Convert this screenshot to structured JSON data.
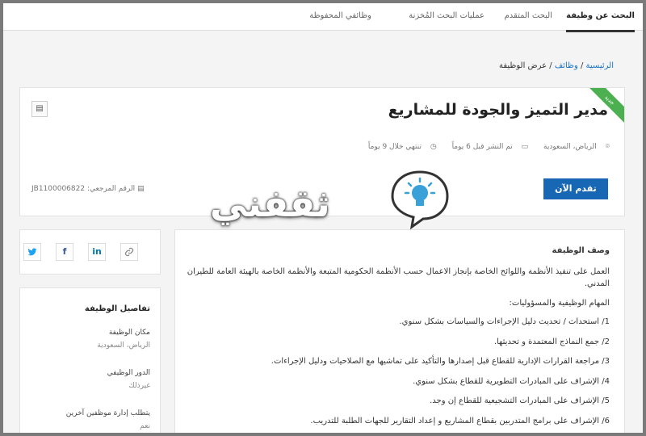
{
  "tabs": [
    "البحث عن وظيفة",
    "البحث المتقدم",
    "عمليات البحث المُخزنة",
    "وظائفي المحفوظة"
  ],
  "breadcrumb": {
    "home": "الرئيسية",
    "sep": " / ",
    "jobs": "وظائف",
    "current": "عرض الوظيفة"
  },
  "job": {
    "title": "مدير التميز والجودة للمشاريع",
    "badge": "جديد",
    "location": "الرياض، السعودية",
    "posted": "تم النشر قبل 6 يوماً",
    "ends": "تنتهي خلال 9 يوماً",
    "apply_label": "تقدم الآن",
    "ref_label": "الرقم المرجعي:",
    "ref_value": "JB1100006822"
  },
  "watermark": {
    "text": "ثقفني"
  },
  "description": {
    "heading": "وصف الوظيفة",
    "intro": "العمل على تنفيذ الأنظمة واللوائح الخاصة بإنجاز الاعمال حسب الأنظمة الحكومية المتبعة والأنظمة الخاصة بالهيئة العامة للطيران المدني.",
    "duties_heading": "المهام الوظيفية والمسؤوليات:",
    "duties": [
      "1/ استحداث / تحديث دليل الإجراءات والسياسات بشكل سنوي.",
      "2/ جمع النماذج المعتمدة و تحديثها.",
      "3/ مراجعة القرارات الإدارية للقطاع قبل إصدارها والتأكيد على تماشيها مع الصلاحيات ودليل الإجراءات.",
      "4/ الإشراف على المبادرات التطويرية للقطاع بشكل سنوي.",
      "5/ الإشراف على المبادرات التشجيعية للقطاع إن وجد.",
      "6/ الإشراف على برامج المتدربين بقطاع المشاريع و إعداد التقارير للجهات الطلبة للتدريب."
    ]
  },
  "share": {
    "twitter": "twitter-icon",
    "facebook": "f",
    "linkedin": "in",
    "link": "link-icon"
  },
  "details": {
    "title": "تفاصيل الوظيفة",
    "items": [
      {
        "label": "مكان الوظيفة",
        "value": "الرياض، السعودية"
      },
      {
        "label": "الدور الوظيفي",
        "value": "غيرذلك"
      },
      {
        "label": "يتطلب إدارة موظفين آخرين",
        "value": "نعم"
      }
    ]
  },
  "colors": {
    "accent": "#1767b4",
    "badge": "#4caf50",
    "link": "#1a73c4"
  }
}
